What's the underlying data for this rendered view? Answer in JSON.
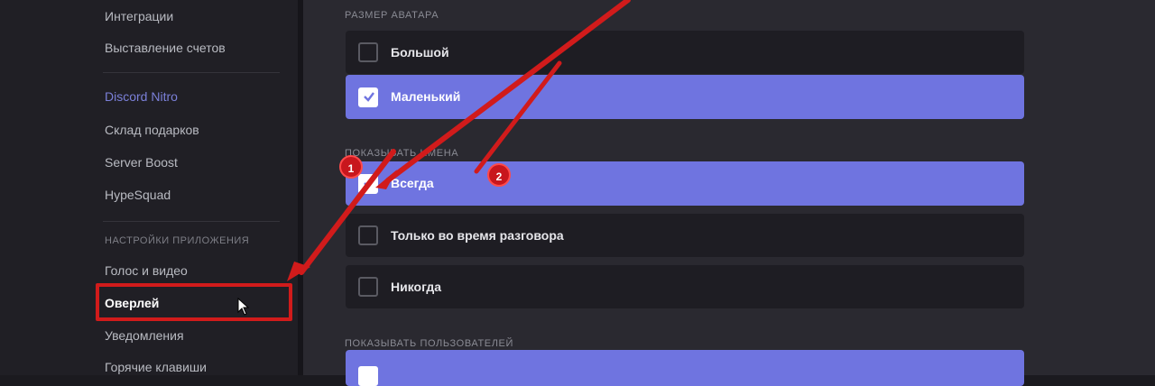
{
  "sidebar": {
    "items": [
      {
        "label": "Интеграции"
      },
      {
        "label": "Выставление счетов"
      },
      {
        "label": "Discord Nitro"
      },
      {
        "label": "Склад подарков"
      },
      {
        "label": "Server Boost"
      },
      {
        "label": "HypeSquad"
      },
      {
        "label": "Голос и видео"
      },
      {
        "label": "Оверлей"
      },
      {
        "label": "Уведомления"
      },
      {
        "label": "Горячие клавиши"
      }
    ],
    "section_header": "Настройки приложения"
  },
  "main": {
    "avatar_size": {
      "header": "Размер аватара",
      "options": [
        {
          "label": "Большой",
          "selected": false
        },
        {
          "label": "Маленький",
          "selected": true
        }
      ]
    },
    "display_names": {
      "header": "Показывать имена",
      "options": [
        {
          "label": "Всегда",
          "selected": true
        },
        {
          "label": "Только во время разговора",
          "selected": false
        },
        {
          "label": "Никогда",
          "selected": false
        }
      ]
    },
    "show_users": {
      "header": "Показывать пользователей"
    }
  },
  "annotations": {
    "badge_1": "1",
    "badge_2": "2"
  },
  "colors": {
    "accent": "#6f74e0",
    "highlight": "#d11b1b",
    "sidebar_accent": "#7b80d9"
  }
}
